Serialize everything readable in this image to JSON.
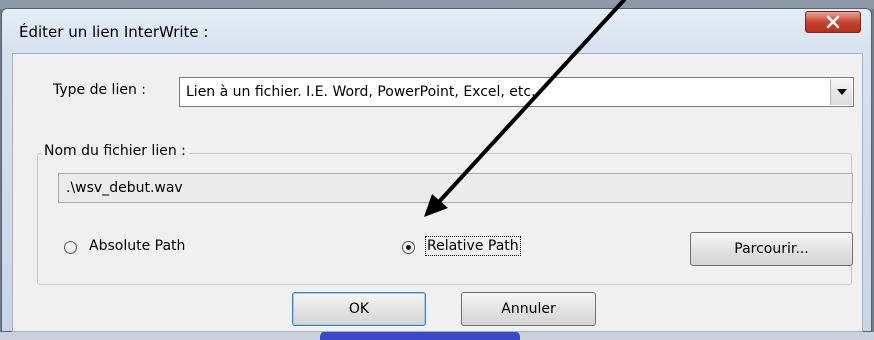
{
  "dialog": {
    "title": "Éditer un lien InterWrite :",
    "close_icon": "close-x-icon"
  },
  "link_type": {
    "label": "Type de lien :",
    "selected_value": "Lien à un fichier. I.E. Word, PowerPoint, Excel, etc."
  },
  "file_group": {
    "legend": "Nom du fichier lien :",
    "path_value": ".\\wsv_debut.wav"
  },
  "path_mode": {
    "absolute_label": "Absolute Path",
    "relative_label": "Relative Path",
    "selected": "relative"
  },
  "buttons": {
    "browse": "Parcourir...",
    "ok": "OK",
    "cancel": "Annuler"
  },
  "colors": {
    "accent_default_button": "#3c7fb1",
    "close_button": "#c9452f",
    "annotation_arrow": "#000000"
  }
}
